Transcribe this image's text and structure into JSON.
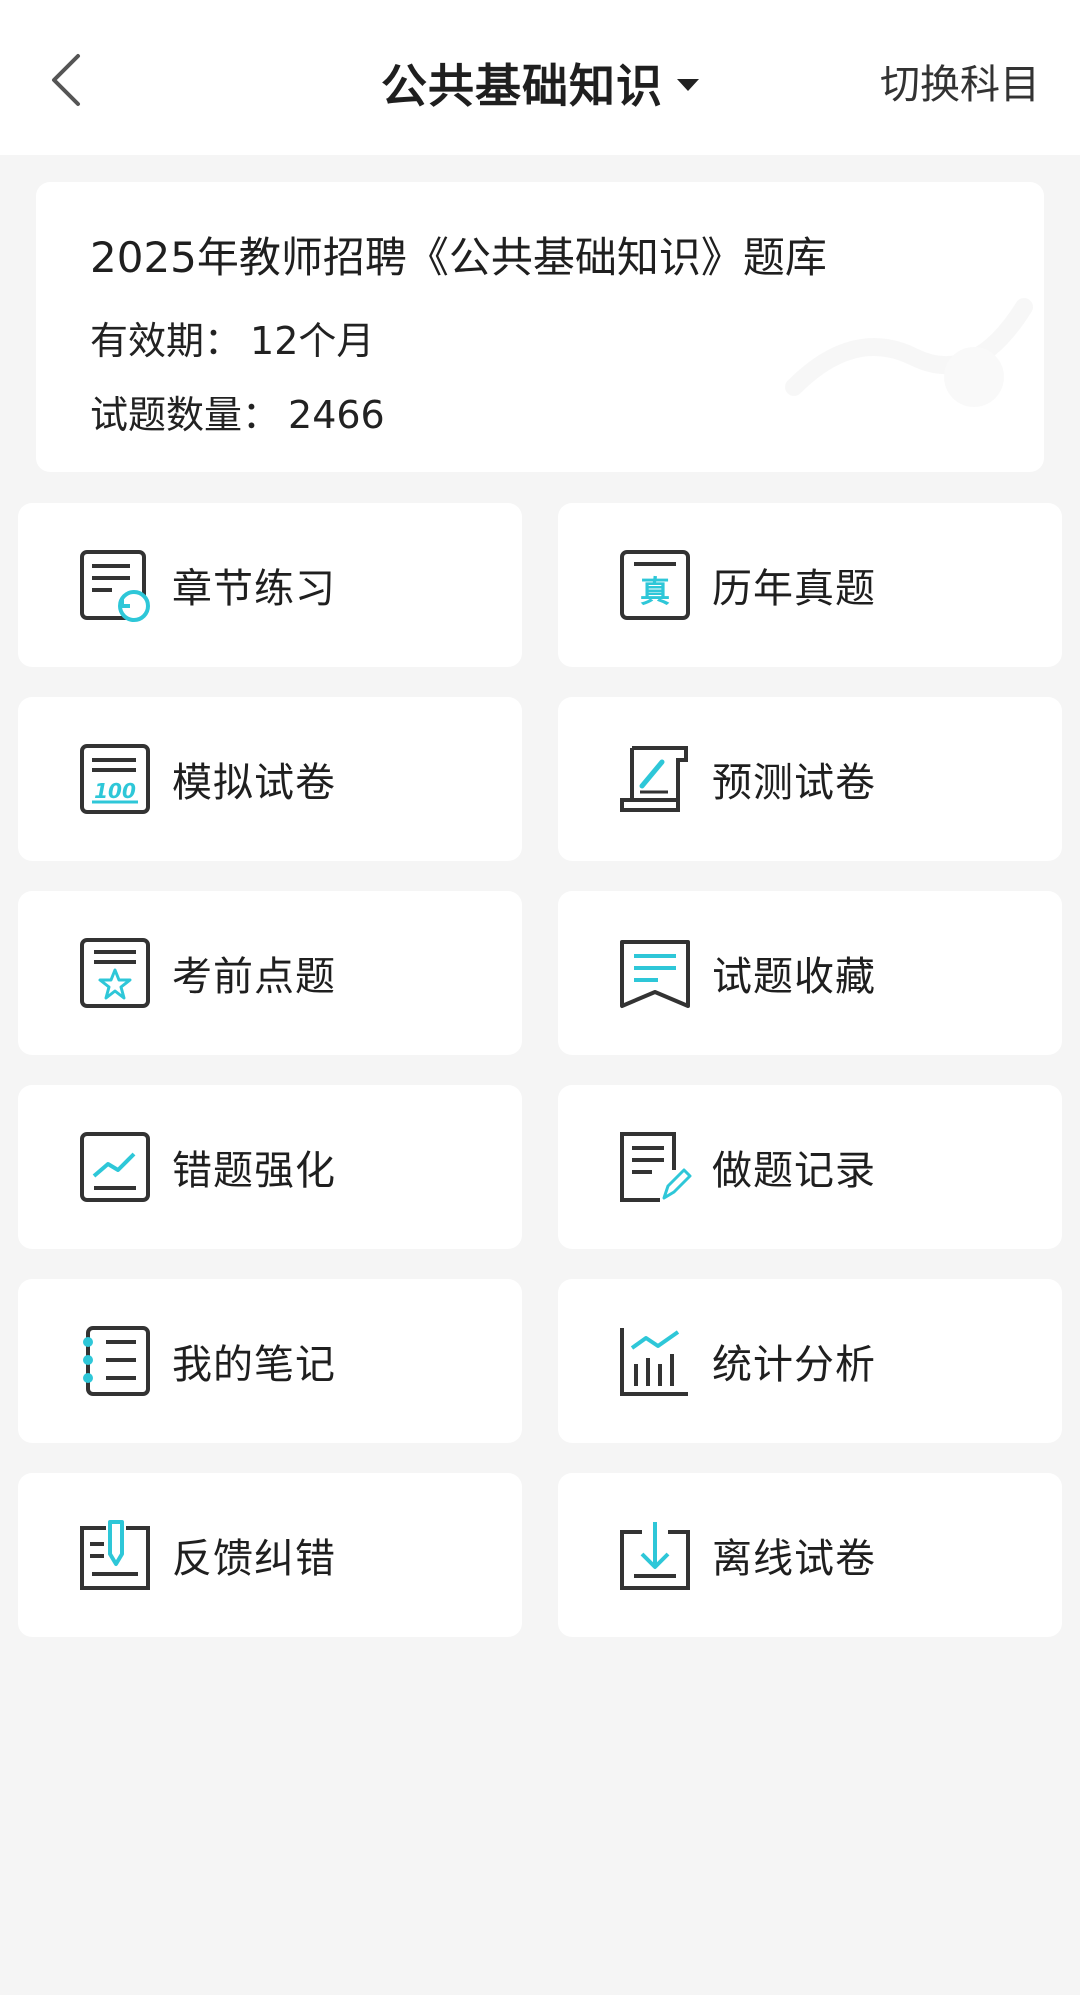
{
  "header": {
    "title": "公共基础知识",
    "switch_label": "切换科目"
  },
  "info": {
    "title": "2025年教师招聘《公共基础知识》题库",
    "validity_label": "有效期：",
    "validity_value": "12个月",
    "count_label": "试题数量：",
    "count_value": "2466"
  },
  "colors": {
    "accent": "#2ec7d8",
    "icon_stroke": "#333333"
  },
  "menu": [
    {
      "label": "章节练习",
      "icon": "chapter-practice-icon"
    },
    {
      "label": "历年真题",
      "icon": "past-exam-icon"
    },
    {
      "label": "模拟试卷",
      "icon": "mock-paper-icon"
    },
    {
      "label": "预测试卷",
      "icon": "forecast-paper-icon"
    },
    {
      "label": "考前点题",
      "icon": "pre-exam-star-icon"
    },
    {
      "label": "试题收藏",
      "icon": "bookmark-icon"
    },
    {
      "label": "错题强化",
      "icon": "wrong-chart-icon"
    },
    {
      "label": "做题记录",
      "icon": "record-edit-icon"
    },
    {
      "label": "我的笔记",
      "icon": "notebook-icon"
    },
    {
      "label": "统计分析",
      "icon": "stats-chart-icon"
    },
    {
      "label": "反馈纠错",
      "icon": "feedback-pen-icon"
    },
    {
      "label": "离线试卷",
      "icon": "download-icon"
    }
  ]
}
